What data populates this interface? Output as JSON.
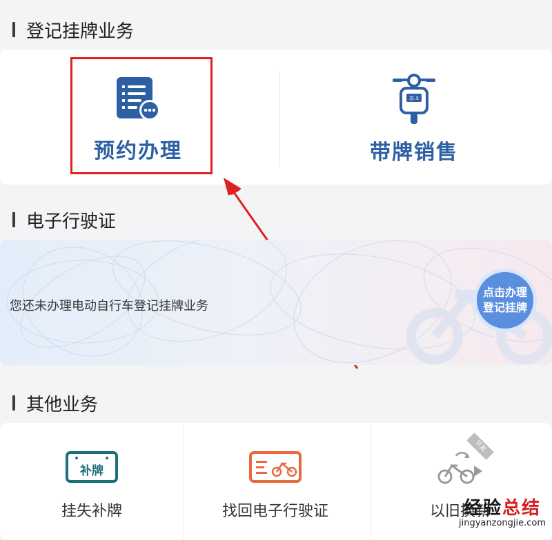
{
  "sections": {
    "register_title": "登记挂牌业务",
    "license_title": "电子行驶证",
    "other_title": "其他业务"
  },
  "register": {
    "appoint_label": "预约办理",
    "plate_sale_label": "带牌销售",
    "plate_sale_icon_text": "苏·X"
  },
  "license": {
    "status_text": "您还未办理电动自行车登记挂牌业务",
    "apply_line1": "点击办理",
    "apply_line2": "登记挂牌"
  },
  "other": {
    "items": [
      {
        "label": "挂失补牌",
        "icon": "plate-replace-icon",
        "icon_text": "补牌"
      },
      {
        "label": "找回电子行驶证",
        "icon": "license-recover-icon"
      },
      {
        "label": "以旧换新",
        "icon": "trade-in-icon",
        "badge": "开发"
      }
    ]
  },
  "watermark": {
    "cn_part1": "经验",
    "cn_part2": "总结",
    "url": "jingyanzongjie.com"
  },
  "colors": {
    "accent_blue": "#2d5fa3",
    "highlight_red": "#e02020",
    "teal": "#1d6f7a",
    "orange": "#e8693f"
  }
}
